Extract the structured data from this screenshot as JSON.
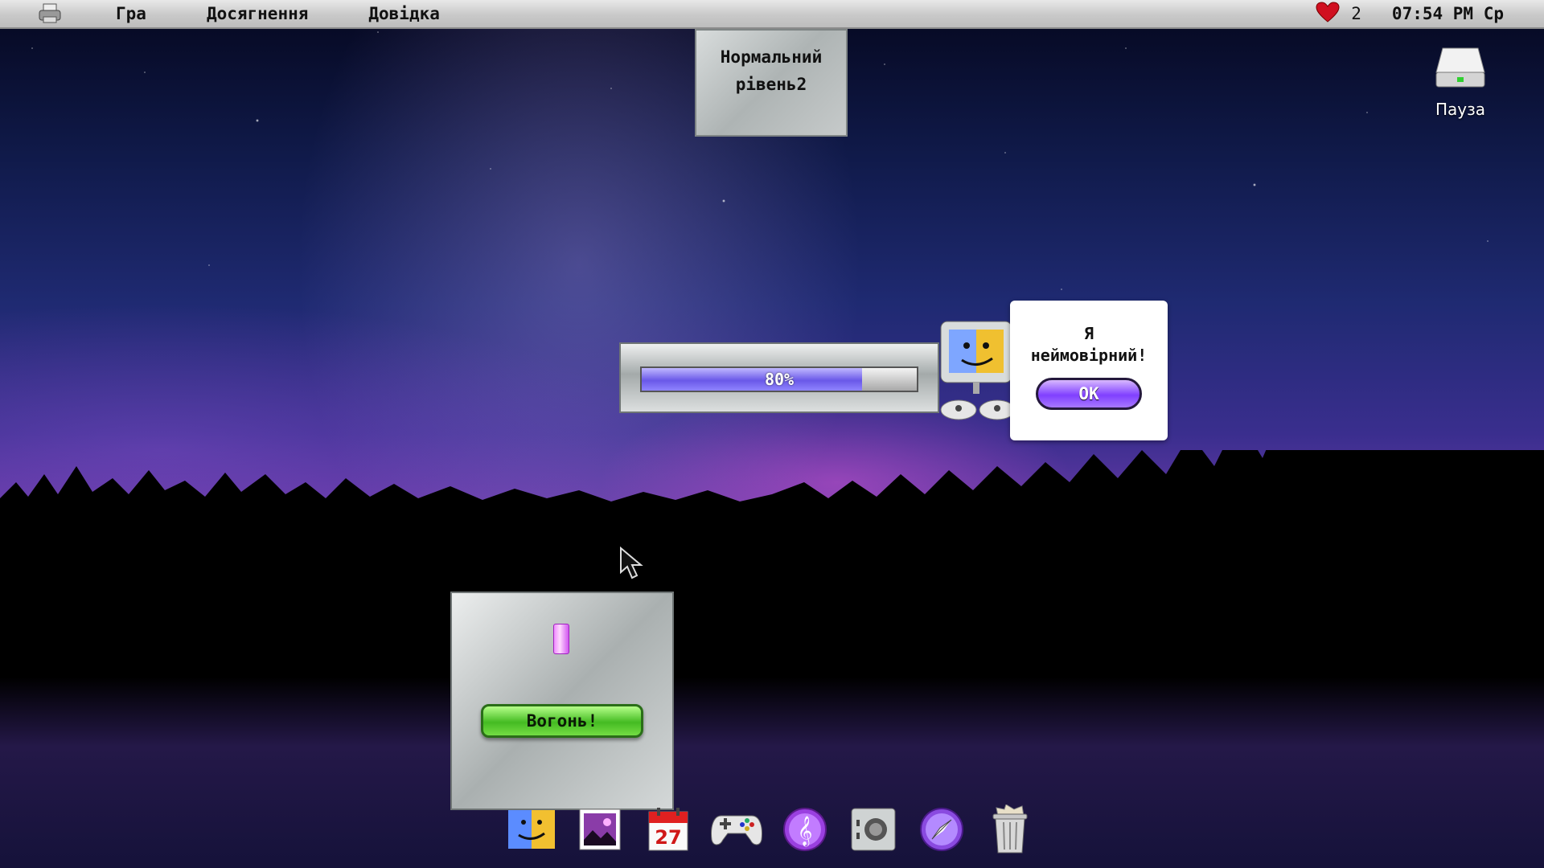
{
  "menubar": {
    "logo_icon": "printer-logo-icon",
    "menus": [
      "Гра",
      "Досягнення",
      "Довідка"
    ],
    "lives": "2",
    "clock": "07:54 PM Ср",
    "heart_color": "#d01020"
  },
  "level": {
    "line1": "Нормальний",
    "line2": "рівень2"
  },
  "drive": {
    "label": "Пауза",
    "icon": "hard-drive-icon"
  },
  "progress": {
    "text": "80%",
    "value": 0.8
  },
  "dialog": {
    "line1": "Я",
    "line2": "неймовірний!",
    "ok_label": "OK"
  },
  "fire": {
    "button_label": "Вогонь!"
  },
  "dock": {
    "items": [
      "finder-icon",
      "photo-icon",
      "calendar-icon",
      "gamepad-icon",
      "music-icon",
      "safe-icon",
      "compass-icon",
      "trash-icon"
    ],
    "calendar_day": "27"
  },
  "colors": {
    "accent_purple": "#8040ff",
    "fire_green": "#44bb22",
    "progress_fill": "#6a58e8"
  }
}
